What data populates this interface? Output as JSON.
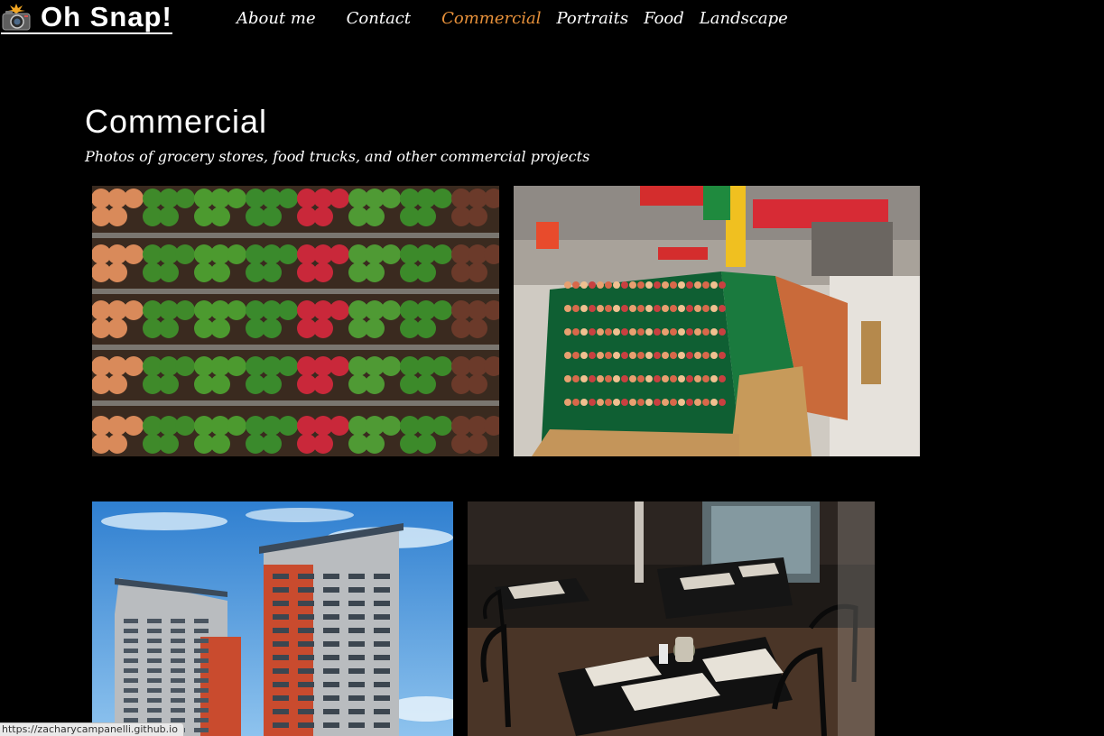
{
  "site": {
    "brand": "Oh Snap!",
    "brand_icon": "camera-flash-icon"
  },
  "nav": {
    "items": [
      {
        "label": "About me",
        "active": false
      },
      {
        "label": "Contact",
        "active": false
      },
      {
        "label": "Commercial",
        "active": true
      },
      {
        "label": "Portraits",
        "active": false
      },
      {
        "label": "Food",
        "active": false
      },
      {
        "label": "Landscape",
        "active": false
      }
    ],
    "active_color": "#e8913a"
  },
  "page": {
    "title": "Commercial",
    "subtitle": "Photos of grocery stores, food trucks, and other commercial projects"
  },
  "gallery": [
    {
      "subject": "produce-shelves-photo"
    },
    {
      "subject": "grocery-store-fruit-aisle-photo"
    },
    {
      "subject": "apartment-buildings-photo"
    },
    {
      "subject": "restaurant-tables-photo"
    }
  ],
  "status_bar": {
    "url": "https://zacharycampanelli.github.io"
  },
  "colors": {
    "background": "#000000",
    "text": "#ffffff"
  }
}
